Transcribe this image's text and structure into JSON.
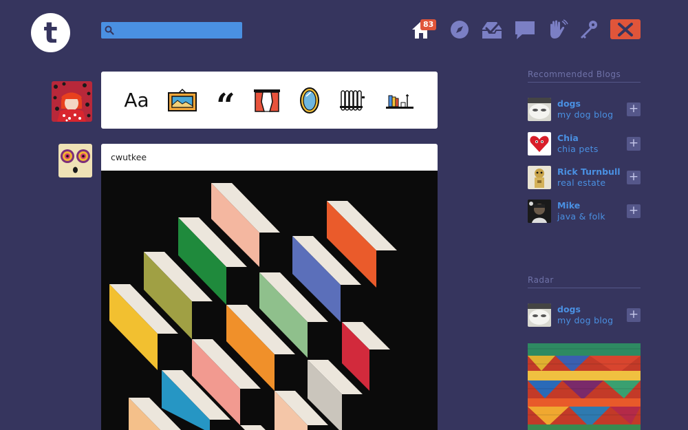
{
  "header": {
    "logo_letter": "t",
    "search": {
      "value": "",
      "placeholder": ""
    },
    "nav": [
      {
        "name": "home-icon",
        "badge": "83"
      },
      {
        "name": "explore-icon"
      },
      {
        "name": "inbox-icon"
      },
      {
        "name": "messages-icon"
      },
      {
        "name": "activity-icon"
      },
      {
        "name": "account-icon"
      }
    ],
    "compose_icon": "pencil-icon"
  },
  "composer": {
    "post_types": [
      {
        "name": "text",
        "label": "Aa"
      },
      {
        "name": "photo",
        "icon": "picture-frame-icon"
      },
      {
        "name": "quote",
        "label": "“"
      },
      {
        "name": "link",
        "icon": "curtain-icon"
      },
      {
        "name": "chat",
        "icon": "mirror-icon"
      },
      {
        "name": "audio",
        "icon": "radiator-icon"
      },
      {
        "name": "video",
        "icon": "bookshelf-icon"
      }
    ]
  },
  "post": {
    "username": "cwutkee"
  },
  "sidebar": {
    "recommended_title": "Recommended Blogs",
    "recommended": [
      {
        "name": "dogs",
        "title": "my dog blog",
        "follow": "+"
      },
      {
        "name": "Chia",
        "title": "chia pets",
        "follow": "+"
      },
      {
        "name": "Rick Turnbull",
        "title": "real estate",
        "follow": "+"
      },
      {
        "name": "Mike",
        "title": "java & folk",
        "follow": "+"
      }
    ],
    "radar_title": "Radar",
    "radar": [
      {
        "name": "dogs",
        "title": "my dog blog",
        "follow": "+"
      }
    ]
  },
  "colors": {
    "background": "#36355e",
    "accent_blue": "#4a90e2",
    "accent_red": "#e0553a",
    "icon_muted": "#7b7fc4"
  }
}
